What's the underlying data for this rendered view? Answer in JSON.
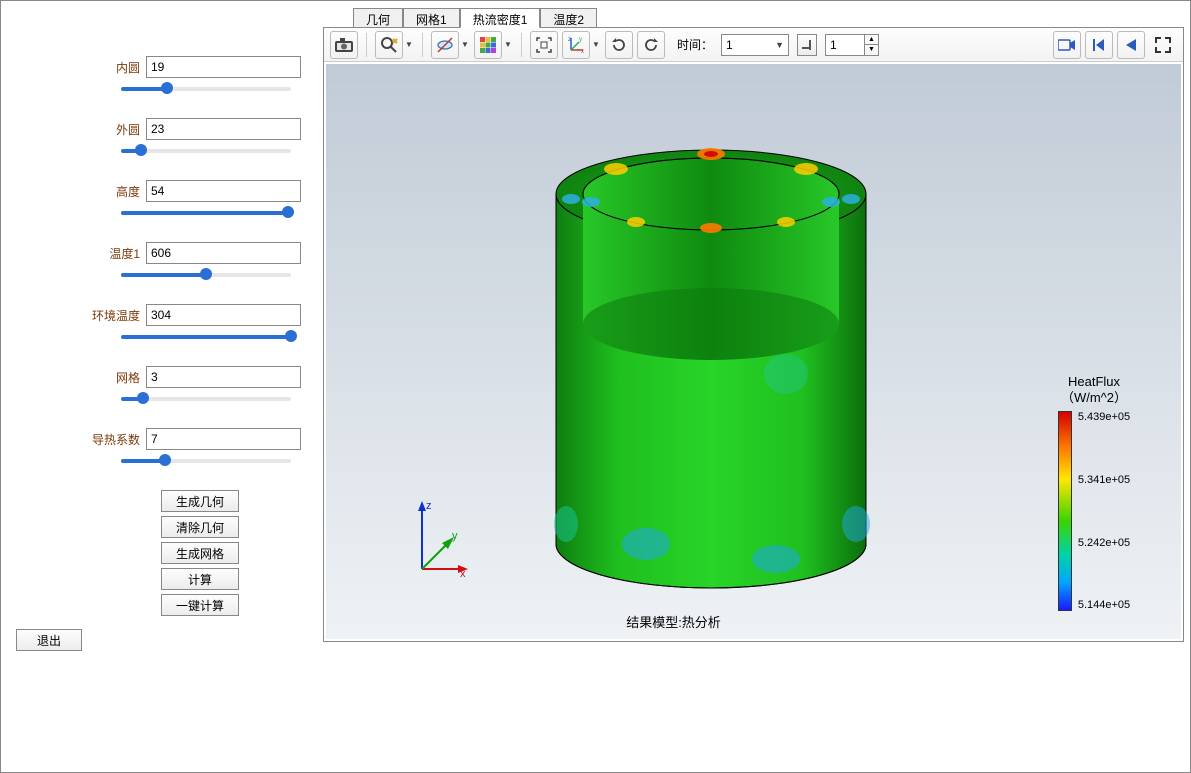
{
  "params": {
    "inner": {
      "label": "内圆",
      "value": "19",
      "pct": 27
    },
    "outer": {
      "label": "外圆",
      "value": "23",
      "pct": 12
    },
    "height": {
      "label": "高度",
      "value": "54",
      "pct": 98
    },
    "temp1": {
      "label": "温度1",
      "value": "606",
      "pct": 50
    },
    "ambient": {
      "label": "环境温度",
      "value": "304",
      "pct": 100
    },
    "mesh": {
      "label": "网格",
      "value": "3",
      "pct": 13
    },
    "conduct": {
      "label": "导热系数",
      "value": "7",
      "pct": 26
    }
  },
  "buttons": {
    "gen_geom": "生成几何",
    "clear_geom": "清除几何",
    "gen_mesh": "生成网格",
    "compute": "计算",
    "one_click": "一键计算",
    "exit": "退出"
  },
  "tabs": {
    "geom": "几何",
    "mesh1": "网格1",
    "heatflux1": "热流密度1",
    "temp2": "温度2"
  },
  "toolbar": {
    "time_label": "时间：",
    "time_value": "1",
    "step_value": "1"
  },
  "viewport": {
    "caption": "结果模型:热分析",
    "axes": {
      "x": "x",
      "y": "y",
      "z": "z"
    },
    "legend": {
      "title1": "HeatFlux",
      "title2": "（W/m^2）",
      "ticks": [
        "5.439e+05",
        "5.341e+05",
        "5.242e+05",
        "5.144e+05"
      ]
    }
  }
}
